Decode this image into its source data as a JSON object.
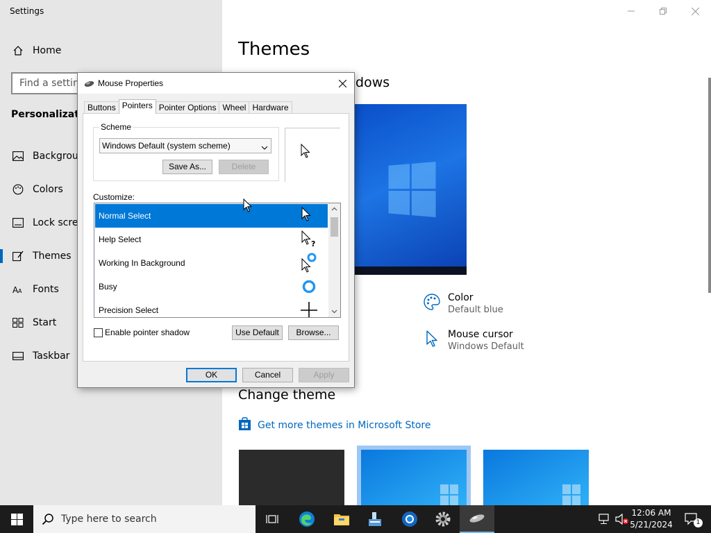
{
  "settings": {
    "app_title": "Settings",
    "home_label": "Home",
    "search_placeholder": "Find a setting",
    "section_title": "Personalization",
    "nav_items": [
      {
        "label": "Background",
        "icon": "image-icon"
      },
      {
        "label": "Colors",
        "icon": "palette-icon"
      },
      {
        "label": "Lock screen",
        "icon": "lock-screen-icon"
      },
      {
        "label": "Themes",
        "icon": "brush-icon",
        "selected": true
      },
      {
        "label": "Fonts",
        "icon": "font-icon"
      },
      {
        "label": "Start",
        "icon": "start-icon"
      },
      {
        "label": "Taskbar",
        "icon": "taskbar-icon"
      }
    ],
    "page_title": "Themes",
    "subhead_visible": "ndows",
    "color_title": "Color",
    "color_value": "Default blue",
    "cursor_title": "Mouse cursor",
    "cursor_value": "Windows Default",
    "change_theme": "Change theme",
    "store_link": "Get more themes in Microsoft Store"
  },
  "dialog": {
    "title": "Mouse Properties",
    "tabs": [
      "Buttons",
      "Pointers",
      "Pointer Options",
      "Wheel",
      "Hardware"
    ],
    "active_tab": "Pointers",
    "scheme_label": "Scheme",
    "scheme_value": "Windows Default (system scheme)",
    "save_as": "Save As...",
    "delete": "Delete",
    "customize_label": "Customize:",
    "cursor_items": [
      {
        "name": "Normal Select",
        "icon": "arrow-cursor-icon",
        "selected": true
      },
      {
        "name": "Help Select",
        "icon": "help-cursor-icon"
      },
      {
        "name": "Working In Background",
        "icon": "working-cursor-icon"
      },
      {
        "name": "Busy",
        "icon": "busy-cursor-icon"
      },
      {
        "name": "Precision Select",
        "icon": "crosshair-cursor-icon"
      }
    ],
    "enable_shadow": "Enable pointer shadow",
    "use_default": "Use Default",
    "browse": "Browse...",
    "ok": "OK",
    "cancel": "Cancel",
    "apply": "Apply"
  },
  "taskbar": {
    "search_placeholder": "Type here to search",
    "time": "12:06 AM",
    "date": "5/21/2024",
    "notification_count": "1"
  },
  "colors": {
    "accent": "#0067c0",
    "selection": "#0078d7",
    "taskbar_bg": "#1c1c1c"
  }
}
